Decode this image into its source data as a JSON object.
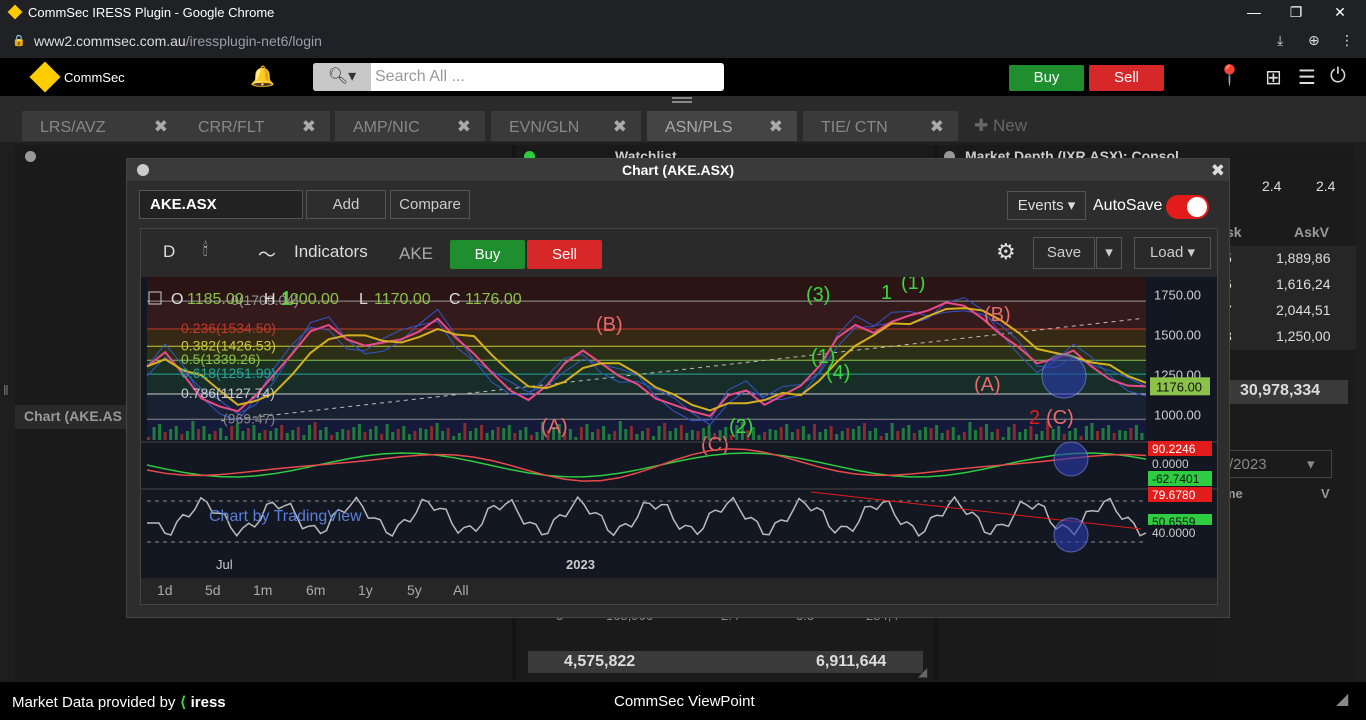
{
  "browser": {
    "title": "CommSec IRESS Plugin - Google Chrome",
    "url_host": "www2.commsec.com.au",
    "url_path": "/iressplugin-net6/login"
  },
  "app": {
    "brand": "CommSec",
    "search_placeholder": "Search All ...",
    "buy_label": "Buy",
    "sell_label": "Sell"
  },
  "tabs": [
    {
      "label": "LRS/AVZ"
    },
    {
      "label": "CRR/FLT"
    },
    {
      "label": "AMP/NIC"
    },
    {
      "label": "EVN/GLN"
    },
    {
      "label": "ASN/PLS"
    },
    {
      "label": "TIE/ CTN"
    }
  ],
  "new_tab_label": "New",
  "background": {
    "watchlist_title": "Watchlist",
    "depth_title": "Market Depth (IXR.ASX): Consol",
    "left_panel_label": "Chart (AKE.AS",
    "depth_top": [
      "2.4",
      "2.4"
    ],
    "ask_header": "sk",
    "askv_header": "AskV",
    "depth_rows": [
      {
        "a": "5",
        "v": "1,889,86"
      },
      {
        "a": "6",
        "v": "1,616,24"
      },
      {
        "a": "7",
        "v": "2,044,51"
      },
      {
        "a": "8",
        "v": "1,250,00"
      }
    ],
    "depth_total": "30,978,334",
    "date_value": "/2023",
    "col_me": "me",
    "col_v": "V",
    "watch_row": [
      "3",
      "165,966",
      "2.4",
      "3.3",
      "284,4"
    ],
    "total_left": "4,575,822",
    "total_right": "6,911,644"
  },
  "dialog": {
    "title": "Chart (AKE.ASX)",
    "symbol": "AKE.ASX",
    "add_label": "Add",
    "compare_label": "Compare",
    "events_label": "Events",
    "autosave_label": "AutoSave",
    "autosave_on": true
  },
  "tv": {
    "interval": "D",
    "indicators_label": "Indicators",
    "symbol": "AKE",
    "buy_label": "Buy",
    "sell_label": "Sell",
    "save_label": "Save",
    "load_label": "Load",
    "ranges": [
      "1d",
      "5d",
      "1m",
      "6m",
      "1y",
      "5y",
      "All"
    ],
    "watermark": "Chart by TradingView",
    "ohlc": {
      "o_label": "O",
      "o": "1185.00",
      "h_label": "H",
      "h": "1200.00",
      "l_label": "L",
      "l": "1170.00",
      "c_label": "C",
      "c": "1176.00"
    }
  },
  "chart_data": {
    "type": "line",
    "symbol": "AKE",
    "interval": "D",
    "x_ticks": [
      "Jul",
      "2023"
    ],
    "price_ticks": [
      1750.0,
      1500.0,
      1250.0,
      1000.0
    ],
    "price_ylim": [
      840,
      1860
    ],
    "last_price": "1176.00",
    "fib_levels": [
      {
        "ratio": "0",
        "value": "1709.04"
      },
      {
        "ratio": "0.236",
        "value": "1534.50"
      },
      {
        "ratio": "0.382",
        "value": "1426.53"
      },
      {
        "ratio": "0.5",
        "value": "1339.26"
      },
      {
        "ratio": "0.618",
        "value": "1251.99"
      },
      {
        "ratio": "0.786",
        "value": "1127.74"
      },
      {
        "ratio": "",
        "value": "969.47"
      }
    ],
    "wave_labels_green": [
      "1",
      "(1)",
      "(2)",
      "(3)",
      "(4)",
      "1",
      "(1)"
    ],
    "wave_labels_red": [
      "(A)",
      "(B)",
      "(C)",
      "(A)",
      "(B)",
      "2",
      "(C)"
    ],
    "series": [
      {
        "name": "",
        "values": [
          1300,
          1390,
          1250,
          1100,
          1050,
          1020,
          1120,
          1250,
          1380,
          1520,
          1560,
          1470,
          1430,
          1450,
          1470,
          1520,
          1600,
          1480,
          1380,
          1260,
          1150,
          1090,
          1180,
          1320,
          1400,
          1320,
          1240,
          1190,
          1100,
          1060,
          1020,
          990,
          1120,
          1150,
          1060,
          1120,
          1180,
          1300,
          1480,
          1560,
          1510,
          1580,
          1620,
          1650,
          1700,
          1680,
          1600,
          1500,
          1420,
          1320,
          1350,
          1400,
          1300,
          1220,
          1180,
          1176
        ]
      }
    ],
    "macd_labels": [
      "90.2246",
      "0.0000",
      "-62.7401"
    ],
    "rsi_labels": [
      "79.6780",
      "50.6559",
      "40.0000"
    ]
  }
}
